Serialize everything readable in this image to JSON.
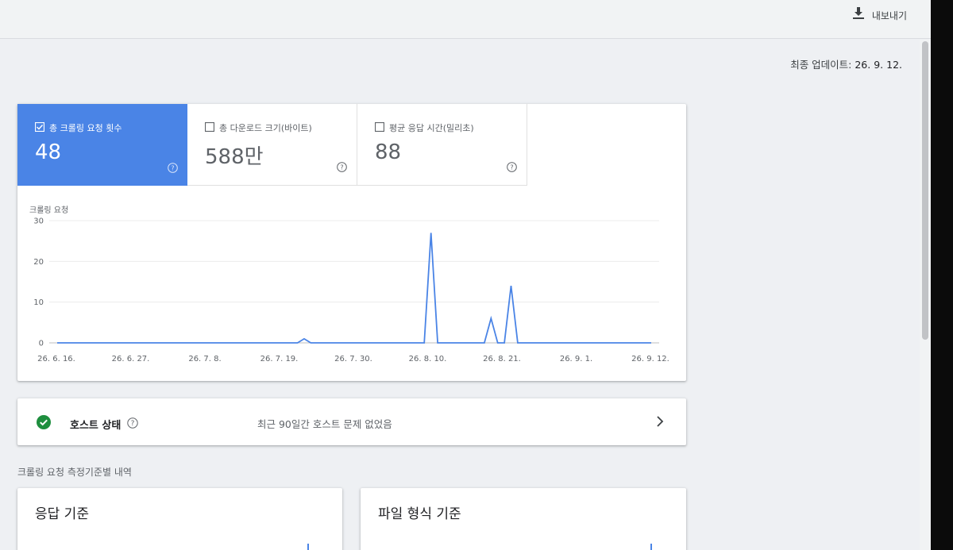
{
  "header": {
    "export_label": "내보내기"
  },
  "last_updated": {
    "label": "최종 업데이트:",
    "value": "26. 9. 12."
  },
  "metrics": [
    {
      "label": "총 크롤링 요청 횟수",
      "value": "48",
      "selected": true
    },
    {
      "label": "총 다운로드 크기(바이트)",
      "value": "588만",
      "selected": false
    },
    {
      "label": "평균 응답 시간(밀리초)",
      "value": "88",
      "selected": false
    }
  ],
  "chart_data": {
    "type": "line",
    "title": "크롤링 요청",
    "ylabel": "",
    "xlabel": "",
    "ylim": [
      0,
      30
    ],
    "y_ticks": [
      "0",
      "10",
      "20",
      "30"
    ],
    "x_ticks": [
      "26. 6. 16.",
      "26. 6. 27.",
      "26. 7. 8.",
      "26. 7. 19.",
      "26. 7. 30.",
      "26. 8. 10.",
      "26. 8. 21.",
      "26. 9. 1.",
      "26. 9. 12."
    ],
    "grid": true,
    "colors": {
      "line": "#4a84e6"
    },
    "series": [
      {
        "values": [
          0,
          0,
          0,
          0,
          0,
          0,
          0,
          0,
          0,
          0,
          0,
          0,
          0,
          0,
          0,
          0,
          0,
          0,
          0,
          0,
          0,
          0,
          0,
          0,
          0,
          0,
          0,
          0,
          0,
          0,
          0,
          0,
          0,
          0,
          0,
          0,
          0,
          1,
          0,
          0,
          0,
          0,
          0,
          0,
          0,
          0,
          0,
          0,
          0,
          0,
          0,
          0,
          0,
          0,
          0,
          0,
          27,
          0,
          0,
          0,
          0,
          0,
          0,
          0,
          0,
          6,
          0,
          0,
          14,
          0,
          0,
          0,
          0,
          0,
          0,
          0,
          0,
          0,
          0,
          0,
          0,
          0,
          0,
          0,
          0,
          0,
          0,
          0,
          0,
          0
        ]
      }
    ]
  },
  "host": {
    "title": "호스트 상태",
    "status": "최근 90일간 호스트 문제 없었음"
  },
  "breakdown": {
    "title": "크롤링 요청 측정기준별 내역",
    "cards": [
      {
        "title": "응답 기준"
      },
      {
        "title": "파일 형식 기준"
      }
    ]
  }
}
